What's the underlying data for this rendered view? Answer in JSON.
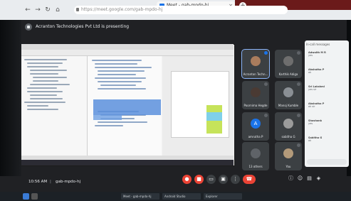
{
  "browser": {
    "tab_title": "Meet - gab-mpdo-hj",
    "url": "https://meet.google.com/gab-mpdo-hj",
    "nav_icons": [
      "back-arrow-icon",
      "forward-arrow-icon",
      "reload-icon",
      "home-icon"
    ]
  },
  "meet": {
    "presenting_text": "Acranton Technologies Pvt Ltd is presenting",
    "participants": [
      {
        "name": "Acranton Techn...",
        "active": true
      },
      {
        "name": "Karthik Adiga",
        "active": false
      },
      {
        "name": "Poornima Hegde",
        "active": false
      },
      {
        "name": "Manoj Kumble",
        "active": false
      },
      {
        "name": "amrutha P",
        "active": false,
        "initial": "A"
      },
      {
        "name": "sabitha G",
        "active": false
      },
      {
        "name": "13 others",
        "active": false
      },
      {
        "name": "You",
        "active": false
      }
    ],
    "chat": {
      "header": "In-call messages",
      "messages": [
        {
          "who": "Adwaith M R",
          "text": "yes"
        },
        {
          "who": "Akshatha P",
          "text": "ok"
        },
        {
          "who": "Sri Lakshmi",
          "text": "yes sir"
        },
        {
          "who": "Akshatha P",
          "text": "ok sir"
        },
        {
          "who": "Shashank",
          "text": "yes"
        },
        {
          "who": "Sabitha G",
          "text": "ok"
        }
      ]
    },
    "time": "10:56 AM",
    "separator": "|",
    "meeting_code": "gab-mpdo-hj"
  },
  "os_taskbar": {
    "apps": [
      "Meet - gab-mpdo-hj",
      "Android Studio",
      "Explorer"
    ]
  },
  "colors": {
    "meet_bg": "#202124",
    "end_call": "#ea4335",
    "accent": "#1a73e8"
  }
}
